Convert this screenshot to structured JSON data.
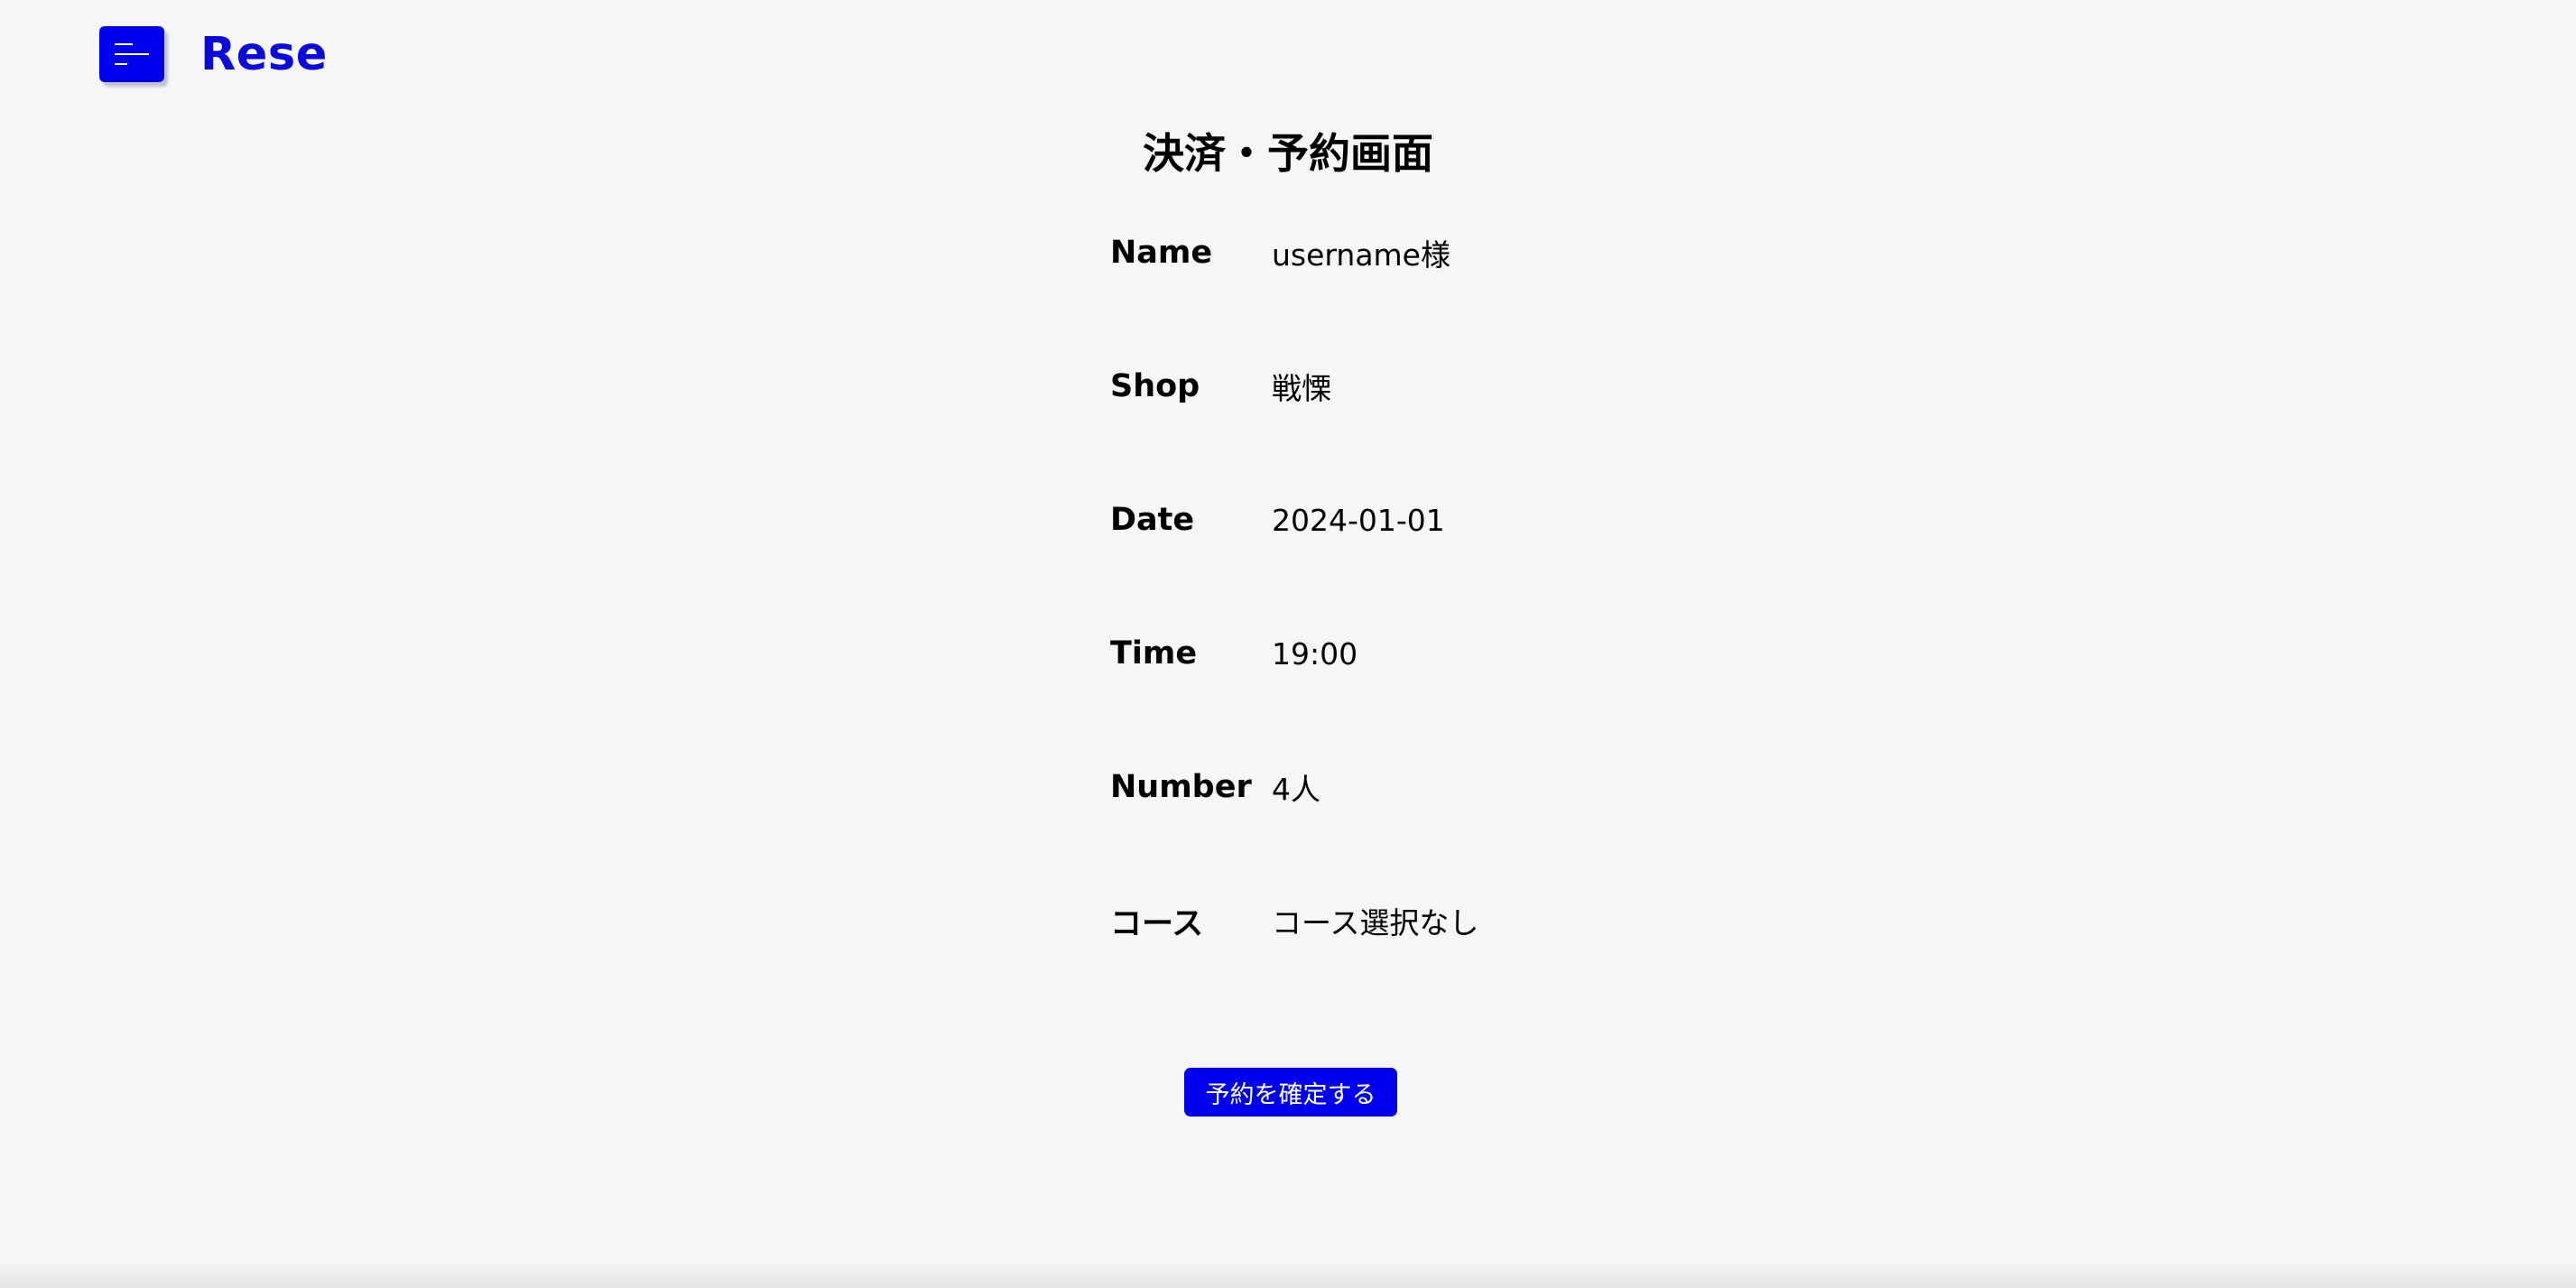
{
  "header": {
    "logo": "Rese",
    "menu_icon": "hamburger-menu-icon"
  },
  "main": {
    "title": "決済・予約画面",
    "rows": [
      {
        "label": "Name",
        "value": "username様"
      },
      {
        "label": "Shop",
        "value": "戦慄"
      },
      {
        "label": "Date",
        "value": "2024-01-01"
      },
      {
        "label": "Time",
        "value": "19:00"
      },
      {
        "label": "Number",
        "value": "4人"
      },
      {
        "label": "コース",
        "value": "コース選択なし"
      }
    ],
    "confirm_label": "予約を確定する"
  },
  "colors": {
    "accent": "#0000ee",
    "logo": "#0a0add",
    "background": "#f6f6f6"
  }
}
